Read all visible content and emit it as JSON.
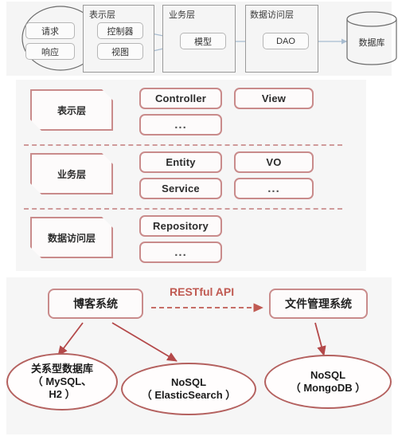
{
  "architecture": {
    "client": {
      "request_label": "请求",
      "response_label": "响应"
    },
    "groups": [
      {
        "title": "表示层",
        "nodes": [
          "控制器",
          "视图"
        ]
      },
      {
        "title": "业务层",
        "nodes": [
          "模型"
        ]
      },
      {
        "title": "数据访问层",
        "nodes": [
          "DAO"
        ]
      }
    ],
    "database_label": "数据库"
  },
  "layers": {
    "rows": [
      {
        "tag": "表示层",
        "col1": [
          "Controller",
          "..."
        ],
        "col2": [
          "View"
        ]
      },
      {
        "tag": "业务层",
        "col1": [
          "Entity",
          "Service"
        ],
        "col2": [
          "VO",
          "..."
        ]
      },
      {
        "tag": "数据访问层",
        "col1": [
          "Repository",
          "..."
        ],
        "col2": []
      }
    ]
  },
  "systems": {
    "blog_system": "博客系统",
    "file_system": "文件管理系统",
    "api_label": "RESTful API",
    "stores": [
      {
        "line1": "关系型数据库",
        "line2": "（ MySQL、",
        "line3": "H2 ）"
      },
      {
        "line1": "NoSQL",
        "line2": "（ ElasticSearch ）",
        "line3": ""
      },
      {
        "line1": "NoSQL",
        "line2": "（ MongoDB ）",
        "line3": ""
      }
    ]
  },
  "colors": {
    "accent_red": "#c05a52",
    "card_border": "#c98b8b",
    "ellipse_border": "#b4615f",
    "schematic_gray": "#9a9a9a",
    "arrow_blue": "#a8bcd0",
    "panel_bg": "#f5f5f5"
  }
}
